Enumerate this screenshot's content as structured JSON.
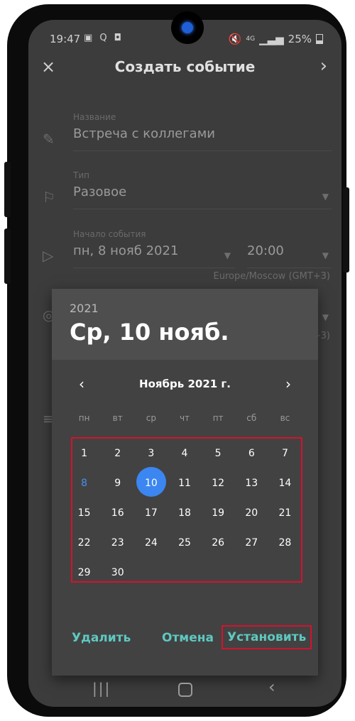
{
  "status_bar": {
    "time": "19:47",
    "left_icons": "▣ Q ◘",
    "network": "4G",
    "battery_percent": "25%"
  },
  "appbar": {
    "title": "Создать событие",
    "close_icon": "×",
    "next_icon": "›"
  },
  "form": {
    "name_label": "Название",
    "name_value": "Встреча с коллегами",
    "type_label": "Тип",
    "type_value": "Разовое",
    "start_label": "Начало события",
    "start_date": "пн, 8 нояб 2021",
    "start_time": "20:00",
    "timezone": "Europe/Moscow (GMT+3)",
    "timezone_tail": "+3)"
  },
  "date_picker": {
    "header_year": "2021",
    "header_date": "Ср, 10 нояб.",
    "month_title": "Ноябрь 2021 г.",
    "weekdays": [
      "пн",
      "вт",
      "ср",
      "чт",
      "пт",
      "сб",
      "вс"
    ],
    "days": [
      "1",
      "2",
      "3",
      "4",
      "5",
      "6",
      "7",
      "8",
      "9",
      "10",
      "11",
      "12",
      "13",
      "14",
      "15",
      "16",
      "17",
      "18",
      "19",
      "20",
      "21",
      "22",
      "23",
      "24",
      "25",
      "26",
      "27",
      "28",
      "29",
      "30"
    ],
    "selected_day": "10",
    "today_day": "8",
    "buttons": {
      "delete": "Удалить",
      "cancel": "Отмена",
      "set": "Установить"
    },
    "accent_color": "#3b86f0",
    "button_color": "#5ec8c0",
    "highlight_color": "#d4122e"
  }
}
